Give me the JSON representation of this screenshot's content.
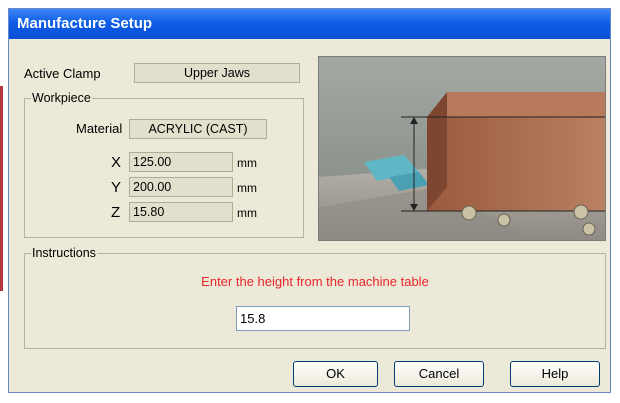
{
  "window": {
    "title": "Manufacture Setup"
  },
  "active_clamp": {
    "label": "Active Clamp",
    "value": "Upper Jaws"
  },
  "workpiece": {
    "legend": "Workpiece",
    "material_label": "Material",
    "material_value": "ACRYLIC (CAST)",
    "x_label": "X",
    "x_value": "125.00",
    "y_label": "Y",
    "y_value": "200.00",
    "z_label": "Z",
    "z_value": "15.80",
    "unit": "mm"
  },
  "instructions": {
    "legend": "Instructions",
    "text": "Enter the height from the machine table",
    "input_value": "15.8",
    "text_color": "#e8262a"
  },
  "buttons": {
    "ok": "OK",
    "cancel": "Cancel",
    "help": "Help"
  },
  "colors": {
    "titlebar": "#0a4fd6",
    "dialog_bg": "#ece9d8"
  }
}
